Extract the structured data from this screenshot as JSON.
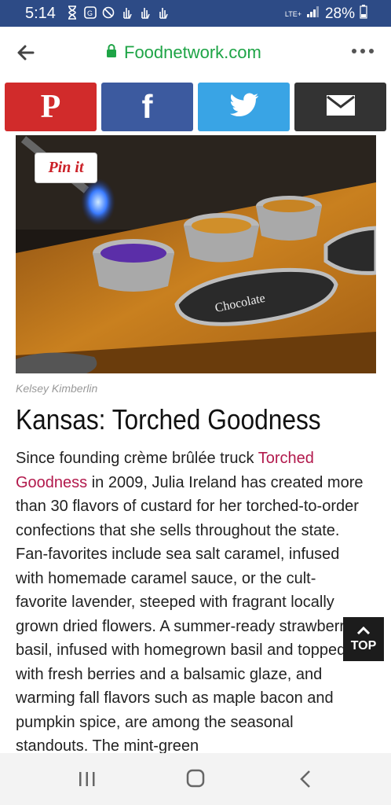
{
  "status_bar": {
    "time": "5:14",
    "network": "LTE+",
    "battery": "28%",
    "icons": [
      "hourglass-icon",
      "app-icon",
      "notification-icon",
      "hand-icon",
      "hand-icon",
      "hand-icon",
      "signal-icon",
      "battery-icon"
    ]
  },
  "browser": {
    "url": "Foodnetwork.com",
    "url_color": "#1ea446"
  },
  "share": {
    "pinterest_glyph": "P",
    "facebook_glyph": "f",
    "colors": {
      "pinterest": "#d12b2b",
      "facebook": "#3c5a9f",
      "twitter": "#39a4e5",
      "email": "#333333"
    }
  },
  "article": {
    "pin_it_label": "Pin it",
    "photo_credit": "Kelsey Kimberlin",
    "headline": "Kansas: Torched Goodness",
    "link_text": "Torched Goodness",
    "link_color": "#b2194c",
    "para_before": "Since founding crème brûlée truck ",
    "para_after": " in 2009, Julia Ireland has created more than 30 flavors of custard for her torched-to-order confections that she sells throughout the state. Fan-favorites include sea salt caramel, infused with homemade caramel sauce, or the cult-favorite lavender, steeped with fragrant locally grown dried flowers. A summer-ready strawberry basil, infused with homegrown basil and topped with fresh berries and a balsamic glaze, and warming fall flavors such as maple bacon and pumpkin spice, are among the seasonal standouts. The mint-green"
  },
  "top_button_label": "TOP"
}
